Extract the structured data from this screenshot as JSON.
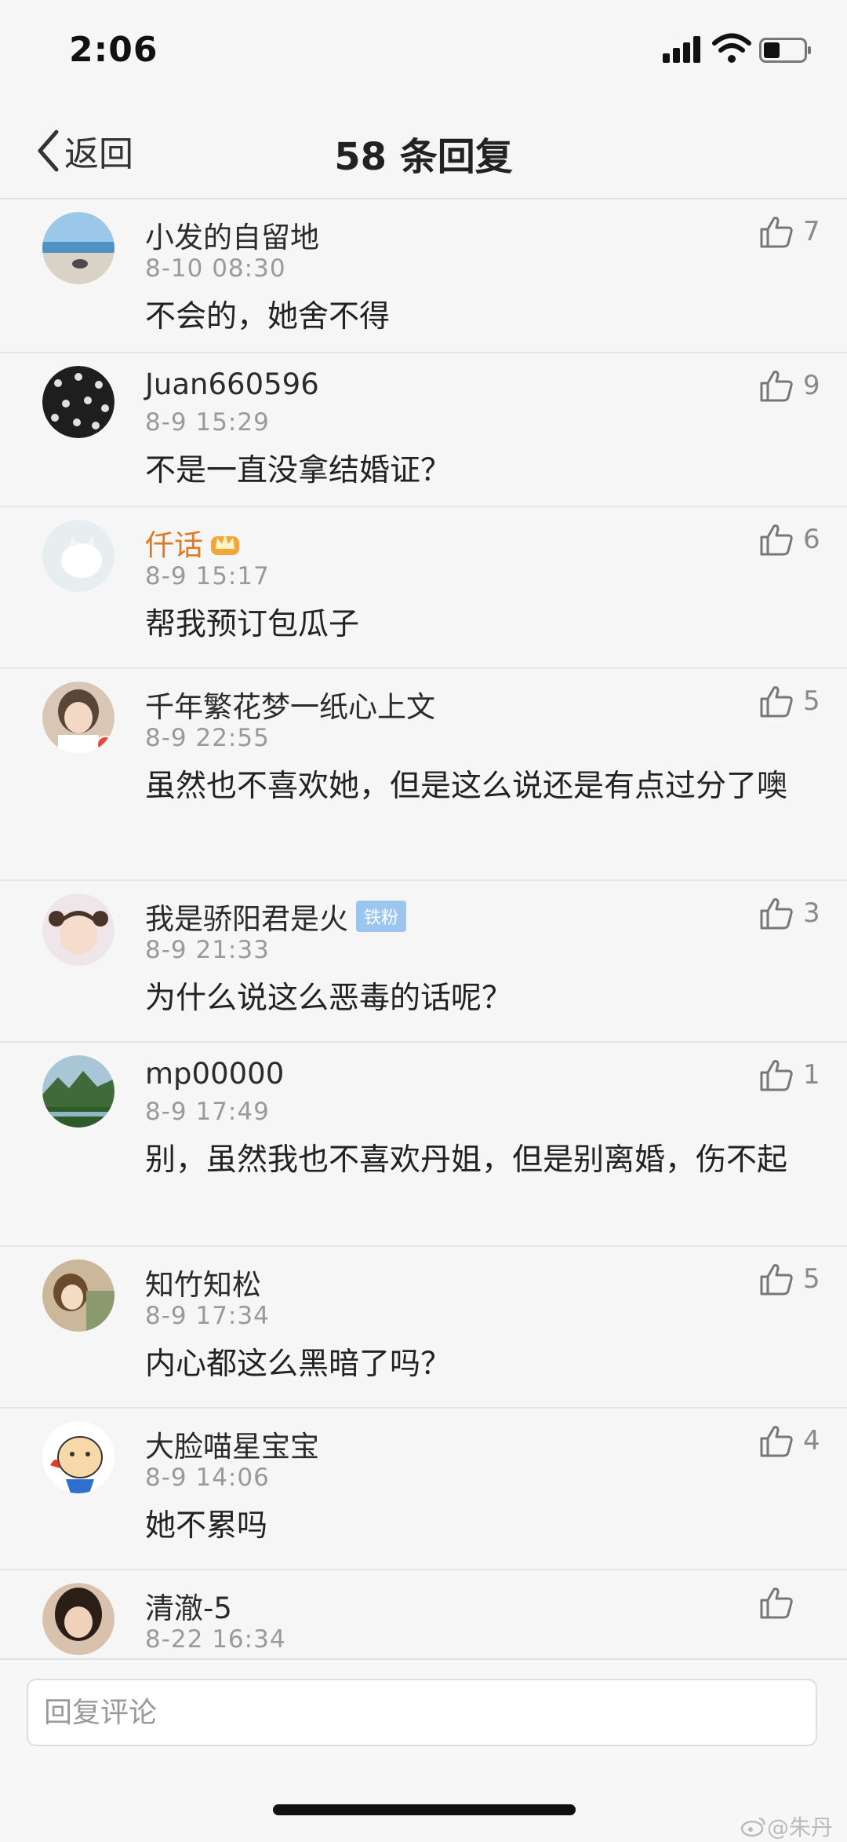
{
  "status_bar": {
    "time": "2:06"
  },
  "nav": {
    "back_label": "返回",
    "title": "58 条回复"
  },
  "comments": [
    {
      "username": "小发的自留地",
      "time": "8-10 08:30",
      "text": "不会的，她舍不得",
      "likes": "7"
    },
    {
      "username": "Juan660596",
      "time": "8-9 15:29",
      "text": "不是一直没拿结婚证？",
      "likes": "9"
    },
    {
      "username": "仟话",
      "time": "8-9 15:17",
      "text": "帮我预订包瓜子",
      "likes": "6"
    },
    {
      "username": "千年繁花梦一纸心上文",
      "time": "8-9 22:55",
      "text": "虽然也不喜欢她，但是这么说还是有点过分了噢",
      "likes": "5"
    },
    {
      "username": "我是骄阳君是火",
      "badge": "铁粉",
      "time": "8-9 21:33",
      "text": "为什么说这么恶毒的话呢？",
      "likes": "3"
    },
    {
      "username": "mp00000",
      "time": "8-9 17:49",
      "text": "别，虽然我也不喜欢丹姐，但是别离婚，伤不起",
      "likes": "1"
    },
    {
      "username": "知竹知松",
      "time": "8-9 17:34",
      "text": "内心都这么黑暗了吗？",
      "likes": "5"
    },
    {
      "username": "大脸喵星宝宝",
      "time": "8-9 14:06",
      "text": "她不累吗",
      "likes": "4"
    },
    {
      "username": "清澈-5",
      "time": "8-22 16:34",
      "text": "",
      "likes": ""
    }
  ],
  "reply_bar": {
    "placeholder": "回复评论"
  },
  "watermark": "@朱丹",
  "colors": {
    "accent_orange": "#e07a1f",
    "fan_badge": "#9cc6ef",
    "background": "#f6f6f6"
  },
  "icons": [
    "back-chevron-icon",
    "thumbs-up-icon",
    "signal-icon",
    "wifi-icon",
    "battery-icon",
    "crown-badge-icon",
    "weibo-icon"
  ]
}
